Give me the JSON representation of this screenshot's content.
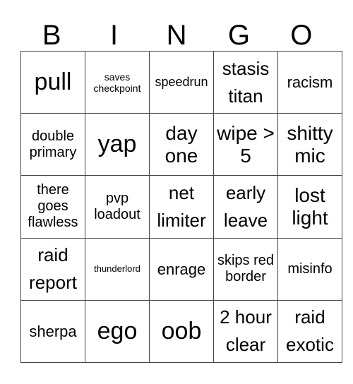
{
  "header": [
    "B",
    "I",
    "N",
    "G",
    "O"
  ],
  "rows": [
    [
      "pull",
      "saves checkpoint",
      "speedrun",
      "stasis titan",
      "racism"
    ],
    [
      "double primary",
      "yap",
      "day one",
      "wipe > 5",
      "shitty mic"
    ],
    [
      "there goes flawless",
      "pvp loadout",
      "net limiter",
      "early leave",
      "lost light"
    ],
    [
      "raid report",
      "thunderlord",
      "enrage",
      "skips red border",
      "misinfo"
    ],
    [
      "sherpa",
      "ego",
      "oob",
      "2 hour clear",
      "raid exotic"
    ]
  ]
}
